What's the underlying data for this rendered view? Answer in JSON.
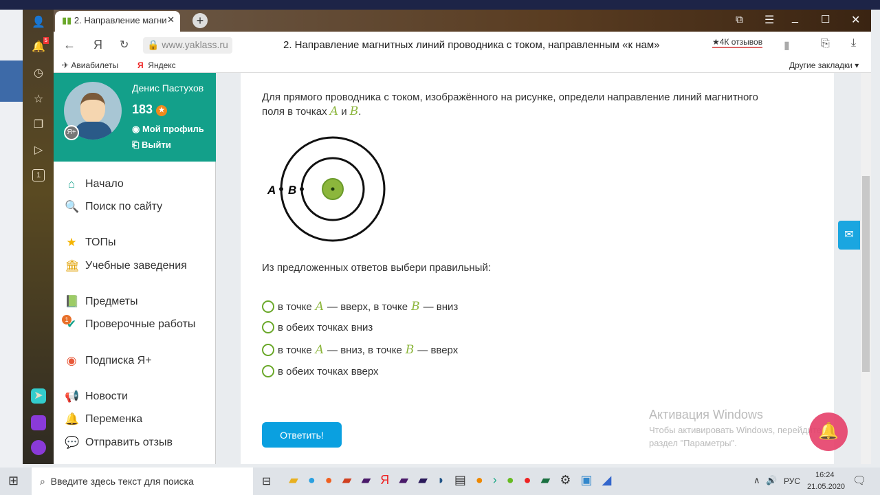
{
  "browser": {
    "tab_title": "2. Направление магни",
    "url": "www.yaklass.ru",
    "page_title": "2. Направление магнитных линий проводника с током, направленным «к нам»",
    "reviews": "★4К отзывов",
    "notif_count": "5",
    "bookmarks": [
      {
        "label": "Авиабилеты"
      },
      {
        "label": "Яндекс"
      }
    ],
    "other_bookmarks": "Другие закладки ▾",
    "tab_counter": "1"
  },
  "profile": {
    "name": "Денис Пастухов",
    "points": "183",
    "my_profile": "Мой профиль",
    "logout": "Выйти"
  },
  "nav": [
    {
      "label": "Начало",
      "icon": "home-icon"
    },
    {
      "label": "Поиск по сайту",
      "icon": "search-icon"
    },
    {
      "label": "ТОПы",
      "icon": "star-icon"
    },
    {
      "label": "Учебные заведения",
      "icon": "institution-icon"
    },
    {
      "label": "Предметы",
      "icon": "book-icon"
    },
    {
      "label": "Проверочные работы",
      "icon": "check-icon",
      "badge": "1"
    },
    {
      "label": "Подписка Я+",
      "icon": "subscription-icon"
    },
    {
      "label": "Новости",
      "icon": "megaphone-icon"
    },
    {
      "label": "Переменка",
      "icon": "bell-icon"
    },
    {
      "label": "Отправить отзыв",
      "icon": "feedback-icon"
    }
  ],
  "task": {
    "q1": "Для прямого проводника с током, изображённого на рисунке, определи направление линий магнитного",
    "q2": "поля в точках ",
    "A": "A",
    "and": " и ",
    "B": "B",
    "dot": ".",
    "label_A": "A",
    "label_B": "B",
    "choose": "Из предложенных ответов выбери правильный:",
    "options": [
      {
        "p1": "в точке ",
        "m1": "A",
        "p2": " — вверх, в точке ",
        "m2": "B",
        "p3": " — вниз"
      },
      {
        "p1": "в обеих точках вниз"
      },
      {
        "p1": "в точке ",
        "m1": "A",
        "p2": " — вниз, в точке ",
        "m2": "B",
        "p3": " — вверх"
      },
      {
        "p1": "в обеих точках вверх"
      }
    ],
    "submit": "Ответить!"
  },
  "watermark": {
    "title": "Активация Windows",
    "line1": "Чтобы активировать Windows, перейдите в",
    "line2": "раздел \"Параметры\"."
  },
  "taskbar": {
    "search_placeholder": "Введите здесь текст для поиска",
    "lang": "РУС",
    "time": "16:24",
    "date": "21.05.2020"
  },
  "colors": {
    "teal": "#13a08a",
    "accent_green": "#8cb63c",
    "button_blue": "#0aa0e0",
    "bell_pink": "#e6406a"
  }
}
